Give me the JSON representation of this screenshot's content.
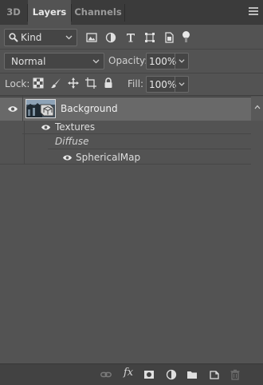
{
  "tabs": [
    {
      "label": "3D"
    },
    {
      "label": "Layers"
    },
    {
      "label": "Channels"
    }
  ],
  "filter": {
    "kind_label": "Kind"
  },
  "blend": {
    "mode": "Normal",
    "opacity_label": "Opacity:",
    "opacity_value": "100%"
  },
  "lock": {
    "label": "Lock:",
    "fill_label": "Fill:",
    "fill_value": "100%"
  },
  "layers": {
    "background": {
      "name": "Background"
    },
    "textures": {
      "name": "Textures"
    },
    "diffuse": {
      "name": "Diffuse"
    },
    "spherical_map": {
      "name": "SphericalMap"
    }
  },
  "colors": {
    "panel": "#535353",
    "tabbar": "#3b3b3b",
    "selected_row": "#696969",
    "footer": "#424242"
  }
}
